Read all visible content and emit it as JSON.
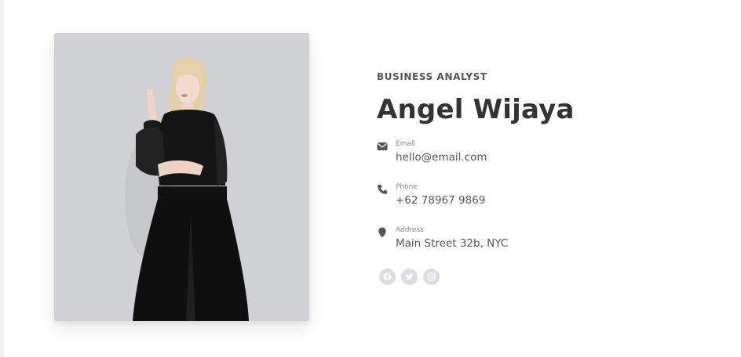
{
  "profile": {
    "role": "BUSINESS ANALYST",
    "name": "Angel Wijaya"
  },
  "contacts": [
    {
      "label": "Email",
      "value": "hello@email.com",
      "icon": "envelope-icon"
    },
    {
      "label": "Phone",
      "value": "+62 78967 9869",
      "icon": "phone-icon"
    },
    {
      "label": "Address",
      "value": "Main Street 32b, NYC",
      "icon": "map-marker-icon"
    }
  ],
  "socials": [
    {
      "icon": "facebook-icon"
    },
    {
      "icon": "twitter-icon"
    },
    {
      "icon": "instagram-icon"
    }
  ],
  "colors": {
    "photo_background": "#d0d1d5",
    "heading": "#333333",
    "text": "#555555",
    "social_circle": "#dcdde0"
  }
}
